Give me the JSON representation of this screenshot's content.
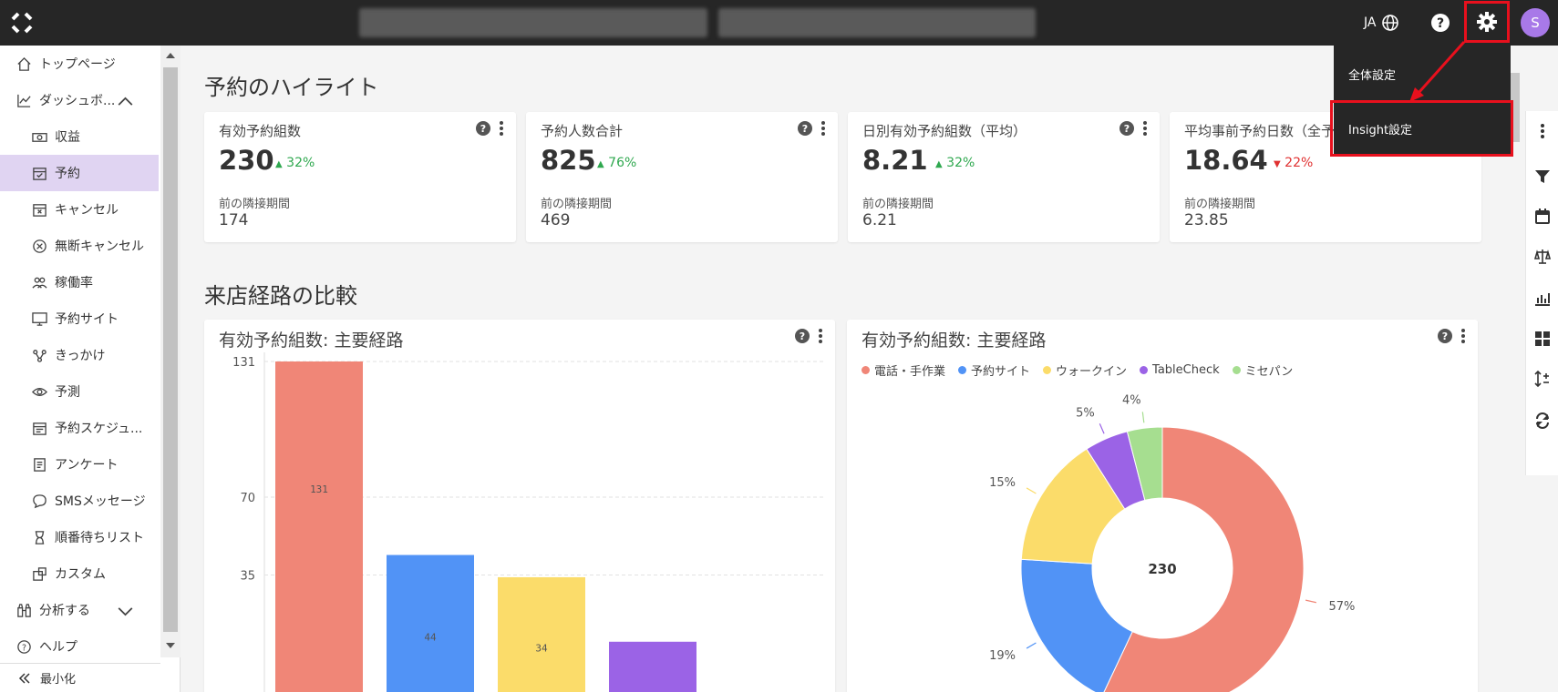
{
  "header": {
    "lang": "JA",
    "avatar_initial": "S"
  },
  "dropdown": {
    "items": [
      "全体設定",
      "Insight設定"
    ]
  },
  "sidebar": {
    "items": [
      {
        "label": "トップページ",
        "icon": "home-icon",
        "level": "top"
      },
      {
        "label": "ダッシュボ...",
        "icon": "dashboard-icon",
        "level": "top",
        "expanded": true
      },
      {
        "label": "収益",
        "icon": "money-icon",
        "level": "sub"
      },
      {
        "label": "予約",
        "icon": "calendar-check-icon",
        "level": "sub",
        "active": true
      },
      {
        "label": "キャンセル",
        "icon": "calendar-x-icon",
        "level": "sub"
      },
      {
        "label": "無断キャンセル",
        "icon": "circle-x-icon",
        "level": "sub"
      },
      {
        "label": "稼働率",
        "icon": "people-icon",
        "level": "sub"
      },
      {
        "label": "予約サイト",
        "icon": "monitor-icon",
        "level": "sub"
      },
      {
        "label": "きっかけ",
        "icon": "share-icon",
        "level": "sub"
      },
      {
        "label": "予測",
        "icon": "eye-icon",
        "level": "sub"
      },
      {
        "label": "予約スケジュ...",
        "icon": "schedule-icon",
        "level": "sub"
      },
      {
        "label": "アンケート",
        "icon": "survey-icon",
        "level": "sub"
      },
      {
        "label": "SMSメッセージ",
        "icon": "chat-icon",
        "level": "sub"
      },
      {
        "label": "順番待ちリスト",
        "icon": "hourglass-icon",
        "level": "sub"
      },
      {
        "label": "カスタム",
        "icon": "custom-icon",
        "level": "sub"
      },
      {
        "label": "分析する",
        "icon": "binoculars-icon",
        "level": "top",
        "expanded": false
      },
      {
        "label": "ヘルプ",
        "icon": "help-circle-icon",
        "level": "top"
      }
    ],
    "minimize": "最小化"
  },
  "highlights": {
    "title": "予約のハイライト",
    "prev_label": "前の隣接期間",
    "cards": [
      {
        "title": "有効予約組数",
        "value": "230",
        "change": "32%",
        "trend": "up",
        "prev": "174"
      },
      {
        "title": "予約人数合計",
        "value": "825",
        "change": "76%",
        "trend": "up",
        "prev": "469"
      },
      {
        "title": "日別有効予約組数（平均）",
        "value": "8.21",
        "change": "32%",
        "trend": "up",
        "prev": "6.21"
      },
      {
        "title": "平均事前予約日数（全予",
        "value": "18.64",
        "change": "22%",
        "trend": "down",
        "prev": "23.85"
      }
    ]
  },
  "comparison": {
    "title": "来店経路の比較",
    "bar_title": "有効予約組数: 主要経路",
    "pie_title": "有効予約組数: 主要経路",
    "pie_center": "230"
  },
  "chart_data": [
    {
      "type": "bar",
      "categories": [
        "電話・手作業",
        "予約サイト",
        "ウォークイン",
        "TableCheck"
      ],
      "values": [
        131,
        44,
        34,
        5
      ],
      "bar_labels": [
        "131",
        "44",
        "34",
        ""
      ],
      "ticks": [
        131,
        70,
        35
      ],
      "colors": [
        "#f08677",
        "#5193f6",
        "#fbdc6a",
        "#9b63e6"
      ],
      "ylim": [
        0,
        131
      ],
      "grid": true
    },
    {
      "type": "pie",
      "categories": [
        "電話・手作業",
        "予約サイト",
        "ウォークイン",
        "TableCheck",
        "ミセパン"
      ],
      "values": [
        57,
        19,
        15,
        5,
        4
      ],
      "labels": [
        "57%",
        "19%",
        "15%",
        "5%",
        "4%"
      ],
      "colors": [
        "#f08677",
        "#5193f6",
        "#fbdc6a",
        "#9b63e6",
        "#a6de90"
      ],
      "center_label": "230",
      "legend_position": "top-left"
    }
  ],
  "colors": {
    "accent": "#e0d4f2",
    "highlight_red": "#e8101d",
    "avatar": "#a879e8"
  }
}
